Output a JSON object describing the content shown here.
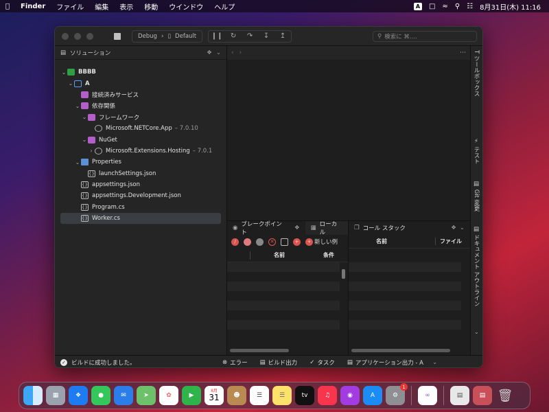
{
  "menubar": {
    "app": "Finder",
    "items": [
      "ファイル",
      "編集",
      "表示",
      "移動",
      "ウインドウ",
      "ヘルプ"
    ],
    "input_indicator": "A",
    "datetime": "8月31日(木)  11:16"
  },
  "toolbar": {
    "config": "Debug",
    "target": "Default",
    "search_placeholder": "検索に ⌘...."
  },
  "solution_pane": {
    "title": "ソリューション",
    "tree": [
      {
        "label": "BBBB",
        "version": ""
      },
      {
        "label": "A",
        "version": ""
      },
      {
        "label": "接続済みサービス",
        "version": ""
      },
      {
        "label": "依存関係",
        "version": ""
      },
      {
        "label": "フレームワーク",
        "version": ""
      },
      {
        "label": "Microsoft.NETCore.App",
        "version": "– 7.0.10"
      },
      {
        "label": "NuGet",
        "version": ""
      },
      {
        "label": "Microsoft.Extensions.Hosting",
        "version": "– 7.0.1"
      },
      {
        "label": "Properties",
        "version": ""
      },
      {
        "label": "launchSettings.json",
        "version": ""
      },
      {
        "label": "appsettings.json",
        "version": ""
      },
      {
        "label": "appsettings.Development.json",
        "version": ""
      },
      {
        "label": "Program.cs",
        "version": ""
      },
      {
        "label": "Worker.cs",
        "version": ""
      }
    ]
  },
  "right_dock": {
    "tabs": [
      "ツールボックス",
      "テスト",
      "Git 変更",
      "ドキュメント アウトライン"
    ]
  },
  "breakpoints_pane": {
    "tab_breakpoints": "ブレークポイント",
    "tab_locals": "ローカル",
    "new_label": "新しい例",
    "col_name": "名前",
    "col_condition": "条件"
  },
  "callstack_pane": {
    "title": "コール スタック",
    "col_name": "名前",
    "col_file": "ファイル"
  },
  "statusbar": {
    "message": "ビルドに成功しました。",
    "pads": [
      "エラー",
      "ビルド出力",
      "タスク",
      "アプリケーション出力 - A"
    ]
  },
  "dock": {
    "calendar_month": "8月",
    "calendar_day": "31",
    "settings_badge": "1",
    "tv_label": "tv"
  }
}
